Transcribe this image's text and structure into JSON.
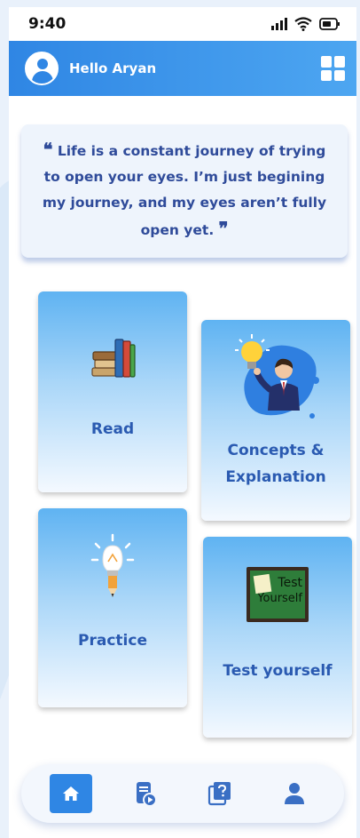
{
  "status_bar": {
    "time": "9:40"
  },
  "header": {
    "greeting": "Hello Aryan",
    "avatar_icon": "user-avatar-icon",
    "menu_icon": "grid-menu-icon",
    "bg_color": "#2f86e4"
  },
  "quote": {
    "open_mark": "❝",
    "text": "Life is a constant journey of trying to open your eyes. I’m just begining my journey, and my eyes aren’t fully open yet.",
    "close_mark": "❞"
  },
  "cards": {
    "read": {
      "label": "Read",
      "icon": "books-icon"
    },
    "concepts": {
      "label": "Concepts & Explanation",
      "icon": "idea-man-icon"
    },
    "practice": {
      "label": "Practice",
      "icon": "lightbulb-pencil-icon"
    },
    "test": {
      "label": "Test yourself",
      "icon": "test-board-icon",
      "board_text_1": "Test",
      "board_text_2": "Yourself"
    }
  },
  "bottom_nav": {
    "items": [
      {
        "name": "home",
        "icon": "home-icon",
        "active": true
      },
      {
        "name": "video",
        "icon": "video-doc-icon",
        "active": false
      },
      {
        "name": "quiz",
        "icon": "question-icon",
        "active": false
      },
      {
        "name": "profile",
        "icon": "profile-icon",
        "active": false
      }
    ]
  },
  "colors": {
    "accent": "#2f86e4",
    "text_blue": "#2a5ab1",
    "quote_blue": "#2f4b9a"
  }
}
